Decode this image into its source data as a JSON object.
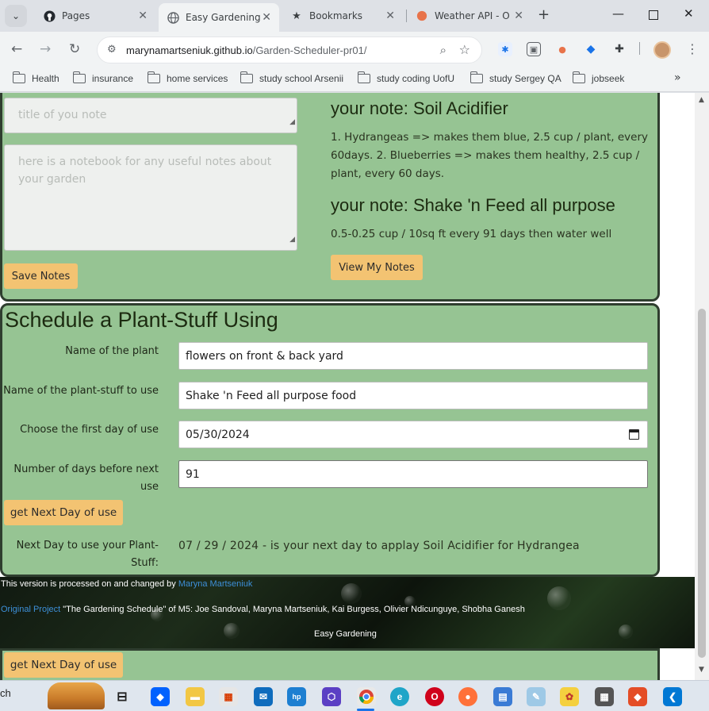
{
  "browser": {
    "tabs": [
      {
        "title": "Pages",
        "icon": "github-icon",
        "active": false
      },
      {
        "title": "Easy Gardening",
        "icon": "globe-icon",
        "active": true
      },
      {
        "title": "Bookmarks",
        "icon": "star-icon",
        "active": false
      },
      {
        "title": "Weather API - O",
        "icon": "weather-icon",
        "active": false
      }
    ],
    "url_host": "marynamartseniuk.github.io",
    "url_path": "/Garden-Scheduler-pr01/",
    "bookmarks": [
      "Health",
      "insurance",
      "home services",
      "study school Arsenii",
      "study coding UofU",
      "study Sergey QA",
      "jobseek"
    ]
  },
  "notes": {
    "title_placeholder": "title of you note",
    "body_placeholder": "here is a notebook for any useful notes about your garden",
    "save_label": "Save Notes",
    "view_label": "View My Notes",
    "saved": [
      {
        "title": "your note: Soil Acidifier",
        "body": "1. Hydrangeas => makes them blue, 2.5 cup / plant, every 60days. 2. Blueberries => makes them healthy, 2.5 cup / plant, every 60 days."
      },
      {
        "title": "your note: Shake 'n Feed all purpose",
        "body": "0.5-0.25 cup / 10sq ft every 91 days then water well"
      }
    ]
  },
  "schedule": {
    "heading": "Schedule a Plant-Stuff Using",
    "plant_label": "Name of the plant",
    "plant_value": "flowers on front & back yard",
    "stuff_label": "Name of the plant-stuff to use",
    "stuff_value": "Shake 'n Feed all purpose food",
    "date_label": "Choose the first day of use",
    "date_value": "05/30/2024",
    "days_label": "Number of days before next use",
    "days_value": "91",
    "button_label": "get Next Day of use",
    "result_label": "Next Day to use your Plant-Stuff:",
    "result_value": "07 / 29 / 2024 - is your next day to applay Soil Acidifier for Hydrangea"
  },
  "footer": {
    "processed_text": "This version is processed on and changed by",
    "author_link": "Maryna Martseniuk",
    "original_link": "Original Project",
    "original_text": "\"The Gardening Schedule\" of M5: Joe Sandoval, Maryna Martseniuk, Kai Burgess, Olivier Ndicunguye, Shobha Ganesh",
    "site_name": "Easy Gardening"
  },
  "bottom_button_label": "get Next Day of use",
  "taskbar": {
    "search_fragment": "ch"
  }
}
